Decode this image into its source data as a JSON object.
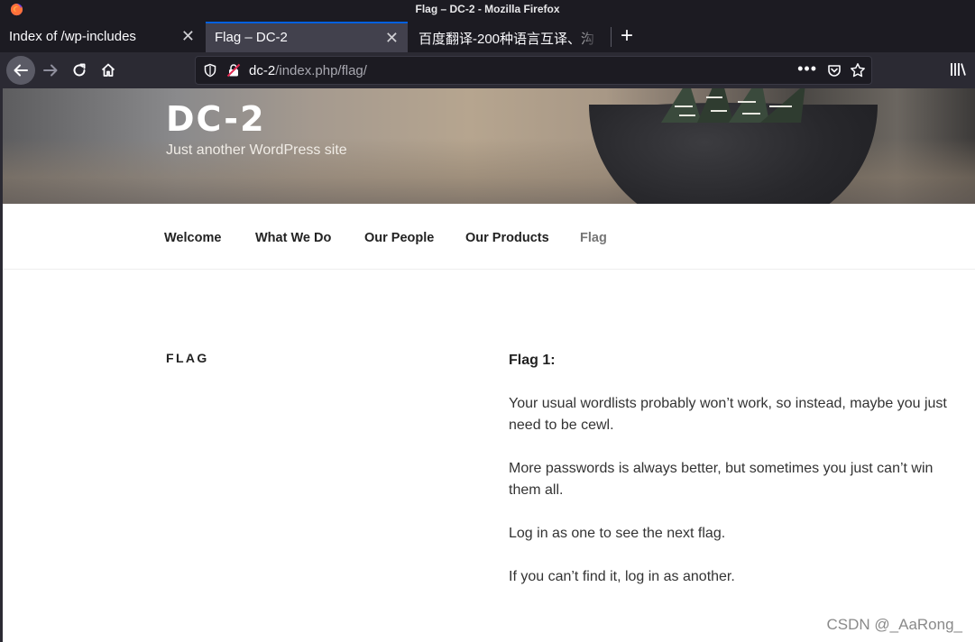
{
  "window": {
    "title": "Flag – DC-2 - Mozilla Firefox"
  },
  "tabs": [
    {
      "label": "Index of /wp-includes",
      "close": "✕"
    },
    {
      "label": "Flag – DC-2",
      "close": "✕",
      "active": true
    },
    {
      "label": "百度翻译-200种语言互译、沟",
      "close": ""
    }
  ],
  "newtab_label": "+",
  "urlbar": {
    "host": "dc-2",
    "path": "/index.php/flag/",
    "more": "•••"
  },
  "site": {
    "title": "DC-2",
    "description": "Just another WordPress site"
  },
  "menu": [
    "Welcome",
    "What We Do",
    "Our People",
    "Our Products",
    "Flag"
  ],
  "page": {
    "heading": "FLAG",
    "flag_title": "Flag 1:",
    "paragraphs": [
      "Your usual wordlists probably won’t work, so instead, maybe you just need to be cewl.",
      "More passwords is always better, but sometimes you just can’t win them all.",
      "Log in as one to see the next flag.",
      "If you can’t find it, log in as another."
    ]
  },
  "watermark": "CSDN @_AaRong_",
  "colors": {
    "accent": "#0060df",
    "toolbar": "#2b2a33",
    "titlebar": "#1c1b22"
  }
}
